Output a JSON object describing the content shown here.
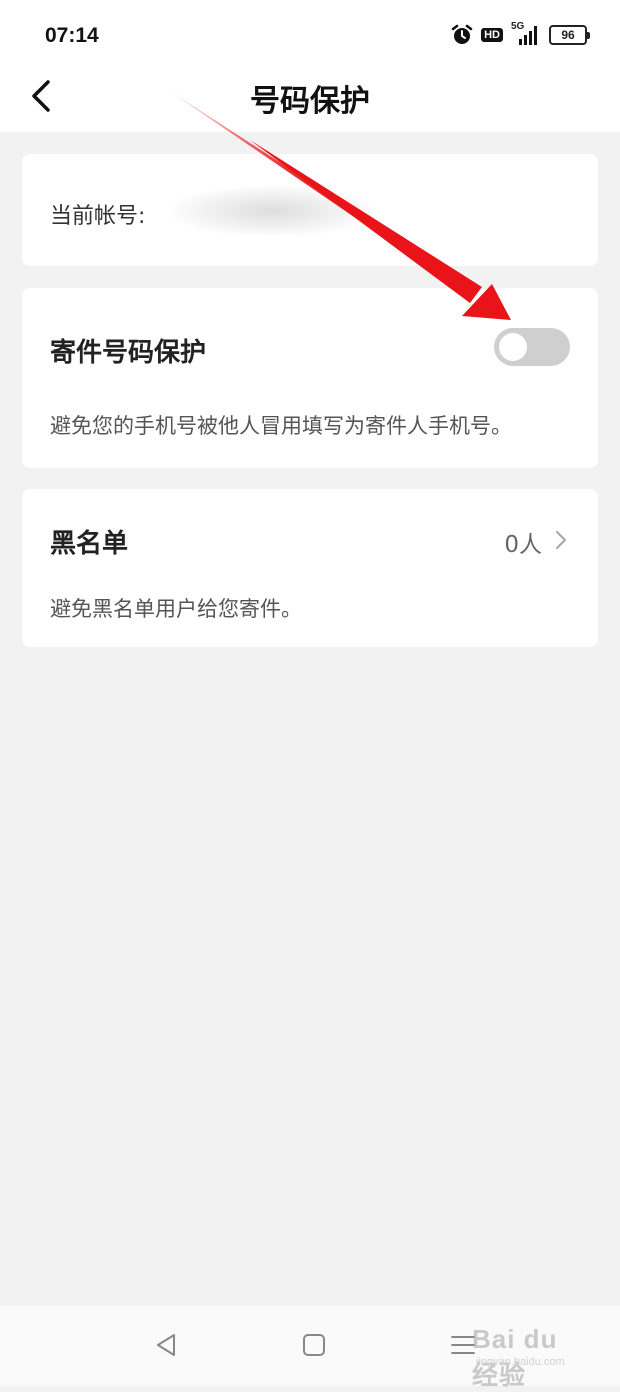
{
  "status_bar": {
    "time": "07:14",
    "hd": "HD",
    "network": "5G",
    "battery": "96"
  },
  "header": {
    "title": "号码保护"
  },
  "account": {
    "label": "当前帐号:"
  },
  "sender_protection": {
    "title": "寄件号码保护",
    "description": "避免您的手机号被他人冒用填写为寄件人手机号。",
    "enabled": false
  },
  "blacklist": {
    "title": "黑名单",
    "count": "0人",
    "description": "避免黑名单用户给您寄件。"
  },
  "watermark": {
    "main": "Bai du 经验",
    "sub": "jingyan.baidu.com"
  },
  "colors": {
    "annotation_arrow": "#e8141a",
    "toggle_off": "#cfcfcf",
    "background": "#f2f2f2"
  }
}
